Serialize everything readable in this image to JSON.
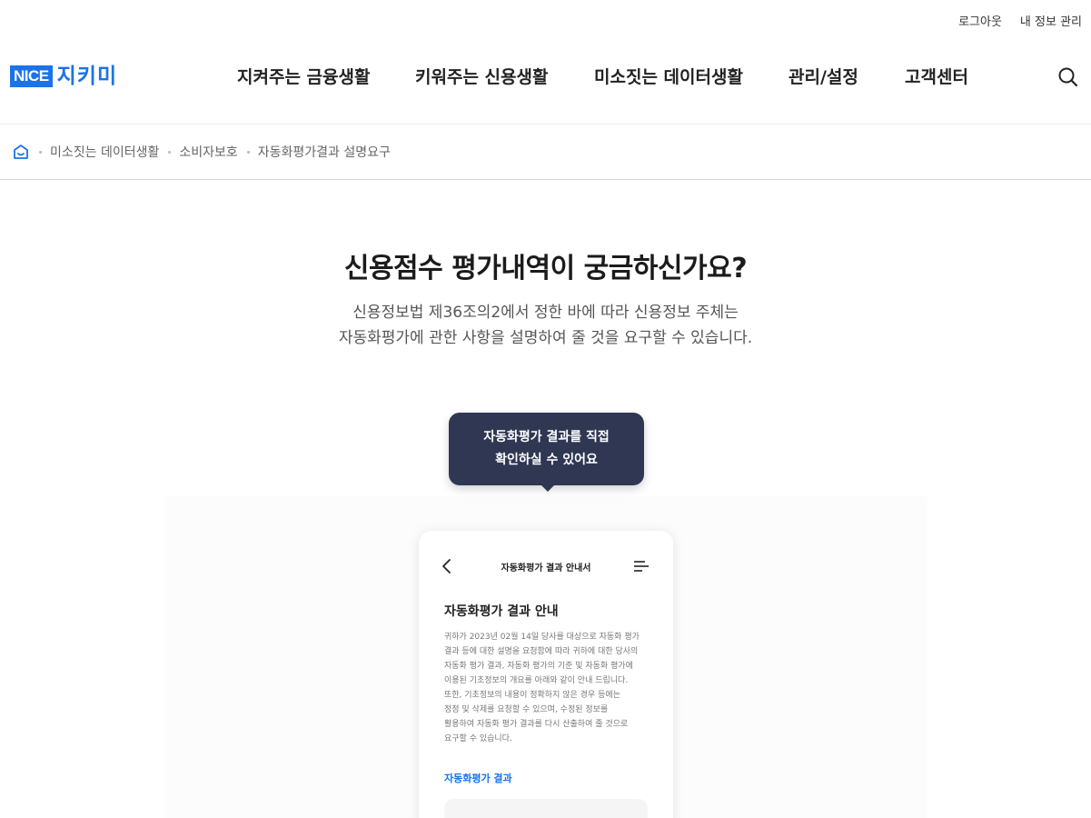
{
  "util": {
    "logout": "로그아웃",
    "my_info": "내 정보 관리"
  },
  "logo": {
    "brand": "NICE",
    "name": "지키미"
  },
  "gnb": [
    {
      "label": "지켜주는 금융생활"
    },
    {
      "label": "키워주는 신용생활"
    },
    {
      "label": "미소짓는 데이터생활"
    },
    {
      "label": "관리/설정"
    },
    {
      "label": "고객센터"
    }
  ],
  "icons": {
    "search": "search-icon",
    "home": "home-icon"
  },
  "breadcrumb": {
    "items": [
      "미소짓는 데이터생활",
      "소비자보호",
      "자동화평가결과 설명요구"
    ]
  },
  "hero": {
    "title": "신용점수 평가내역이 궁금하신가요?",
    "desc_line1": "신용정보법 제36조의2에서 정한 바에 따라 신용정보 주체는",
    "desc_line2": "자동화평가에 관한 사항을 설명하여 줄 것을 요구할 수 있습니다."
  },
  "tooltip": {
    "line1": "자동화평가 결과를 직접",
    "line2": "확인하실 수 있어요"
  },
  "phone": {
    "header_title": "자동화평가 결과 안내서",
    "heading": "자동화평가 결과 안내",
    "body_lines": [
      "귀하가 2023년 02월 14일 당사를 대상으로 자동화 평가",
      "결과 등에 대한 설명을 요청함에 따라 귀하에 대한 당사의",
      "자동화 평가 결과, 자동화 평가의 기준 및 자동화 평가에",
      "이용된 기초정보의 개요를 아래와 같이 안내 드립니다.",
      "또한, 기초정보의 내용이 정확하지 않은 경우 등에는",
      "정정 및 삭제를 요청할 수 있으며, 수정된 정보를",
      "활용하여 자동화 평가 결과를 다시 산출하여 줄 것으로",
      "요구할 수 있습니다."
    ],
    "result_label": "자동화평가 결과"
  },
  "colors": {
    "brand": "#1a73e8",
    "tooltip_bg": "#2f3753"
  }
}
